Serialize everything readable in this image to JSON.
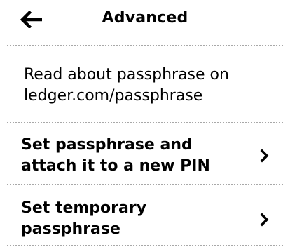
{
  "header": {
    "title": "Advanced",
    "back_icon": "arrow-left-icon"
  },
  "info": {
    "line1": "Read about passphrase on",
    "line2": "ledger.com/passphrase"
  },
  "menu": {
    "items": [
      {
        "line1": "Set passphrase and",
        "line2": "attach it to a new PIN",
        "icon": "chevron-right-icon"
      },
      {
        "line1": "Set temporary",
        "line2": "passphrase",
        "icon": "chevron-right-icon"
      }
    ]
  },
  "colors": {
    "background": "#ffffff",
    "text": "#000000",
    "divider": "#a8a8a8"
  }
}
